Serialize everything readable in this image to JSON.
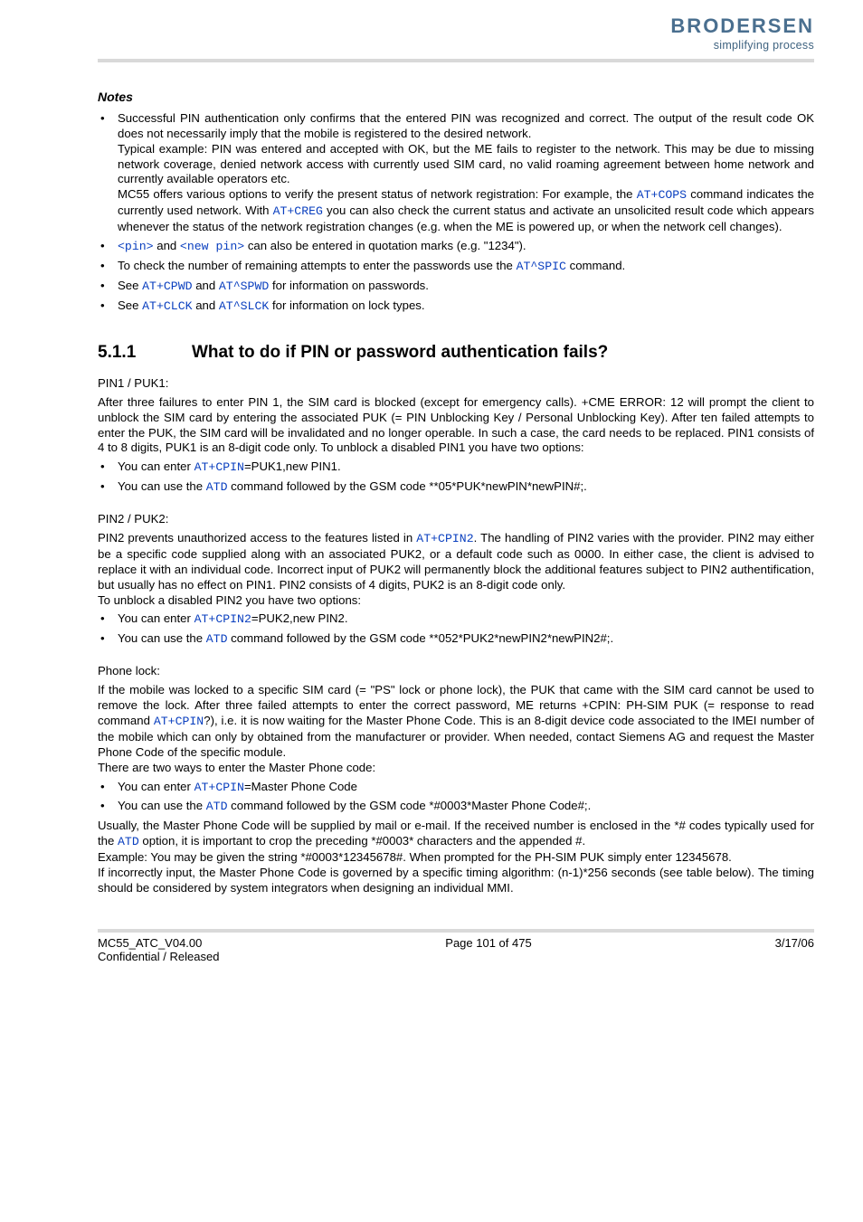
{
  "logo": {
    "text": "BRODERSEN",
    "tagline": "simplifying process"
  },
  "notes": {
    "heading": "Notes",
    "b1_a": "Successful PIN authentication only confirms that the entered PIN was recognized and correct. The output of the result code OK does not necessarily imply that the mobile is registered to the desired network.",
    "b1_b": "Typical example: PIN was entered and accepted with OK, but the ME fails to register to the network. This may be due to missing network coverage, denied network access with currently used SIM card, no valid roaming agreement between home network and currently available operators etc.",
    "b1_c_pre": "MC55 offers various options to verify the present status of network registration: For example, the ",
    "b1_c_cops": "AT+COPS",
    "b1_c_mid": " command indicates the currently used network. With ",
    "b1_c_creg": "AT+CREG",
    "b1_c_post": " you can also check the current status and activate an unsolicited result code which appears whenever the status of the network registration changes (e.g. when the ME is powered up, or when the network cell changes).",
    "b2_pin": "<pin>",
    "b2_and": " and ",
    "b2_newpin": "<new pin>",
    "b2_post": " can also be entered in quotation marks (e.g. \"1234\").",
    "b3_pre": "To check the number of remaining attempts to enter the passwords use the ",
    "b3_spic": "AT^SPIC",
    "b3_post": " command.",
    "b4_see": "See ",
    "b4_cpwd": "AT+CPWD",
    "b4_and": " and ",
    "b4_spwd": "AT^SPWD",
    "b4_post": " for information on passwords.",
    "b5_see": "See ",
    "b5_clck": "AT+CLCK",
    "b5_and": " and ",
    "b5_slck": "AT^SLCK",
    "b5_post": " for information on lock types."
  },
  "section": {
    "num": "5.1.1",
    "title": "What to do if PIN or password authentication fails?"
  },
  "pin1": {
    "head": "PIN1 / PUK1:",
    "para": "After three failures to enter PIN 1, the SIM card is blocked (except for emergency calls). +CME ERROR: 12 will prompt the client to unblock the SIM card by entering the associated PUK (= PIN Unblocking Key / Personal Unblocking Key). After ten failed attempts to enter the PUK, the SIM card will be invalidated and no longer operable. In such a case, the card needs to be replaced. PIN1 consists of 4 to 8 digits, PUK1 is an 8-digit code only. To unblock a disabled PIN1 you have two options:",
    "li1_pre": "You can enter ",
    "li1_cmd": "AT+CPIN",
    "li1_post": "=PUK1,new PIN1.",
    "li2_pre": "You can use the ",
    "li2_cmd": "ATD",
    "li2_post": " command followed by the GSM code **05*PUK*newPIN*newPIN#;."
  },
  "pin2": {
    "head": "PIN2 / PUK2:",
    "para_pre": "PIN2 prevents unauthorized access to the features listed in ",
    "para_cmd": "AT+CPIN2",
    "para_post": ". The handling of PIN2 varies with the provider. PIN2 may either be a specific code supplied along with an associated PUK2, or a default code such as 0000. In either case, the client is advised to replace it with an individual code. Incorrect input of PUK2 will permanently block the additional features subject to PIN2 authentification, but usually has no effect on PIN1. PIN2 consists of 4 digits, PUK2 is an 8-digit code only.",
    "para2": "To unblock a disabled PIN2 you have two options:",
    "li1_pre": "You can enter ",
    "li1_cmd": "AT+CPIN2",
    "li1_post": "=PUK2,new PIN2.",
    "li2_pre": "You can use the ",
    "li2_cmd": "ATD",
    "li2_post": " command followed by the GSM code **052*PUK2*newPIN2*newPIN2#;."
  },
  "phone": {
    "head": "Phone lock:",
    "p1_pre": "If the mobile was locked to a specific SIM card (= \"PS\" lock or phone lock), the PUK that came with the SIM card cannot be used to remove the lock. After three failed attempts to enter the correct password, ME returns +CPIN: PH-SIM PUK (= response to read command ",
    "p1_cmd": "AT+CPIN",
    "p1_post": "?), i.e. it is now waiting for the Master Phone Code. This is an 8-digit device code associated to the IMEI number of the mobile which can only by obtained from the manufacturer or provider. When needed, contact Siemens AG and request the Master Phone Code of the specific module.",
    "p2": "There are two ways to enter the Master Phone code:",
    "li1_pre": "You can enter ",
    "li1_cmd": "AT+CPIN",
    "li1_post": "=Master Phone Code",
    "li2_pre": "You can use the ",
    "li2_cmd": "ATD",
    "li2_post": " command followed by the GSM code *#0003*Master Phone Code#;.",
    "p3_pre": "Usually, the Master Phone Code will be supplied by mail or e-mail. If the received number is enclosed in the *# codes typically used for the ",
    "p3_cmd": "ATD",
    "p3_post": " option, it is important to crop the preceding *#0003* characters and the appended #.",
    "p4": "Example: You may be given the string *#0003*12345678#. When prompted for the PH-SIM PUK simply enter 12345678.",
    "p5": "If incorrectly input, the Master Phone Code is governed by a specific timing algorithm: (n-1)*256 seconds (see table below). The timing should be considered by system integrators when designing an individual MMI."
  },
  "footer": {
    "left1": "MC55_ATC_V04.00",
    "center": "Page 101 of 475",
    "right": "3/17/06",
    "left2": "Confidential / Released"
  }
}
